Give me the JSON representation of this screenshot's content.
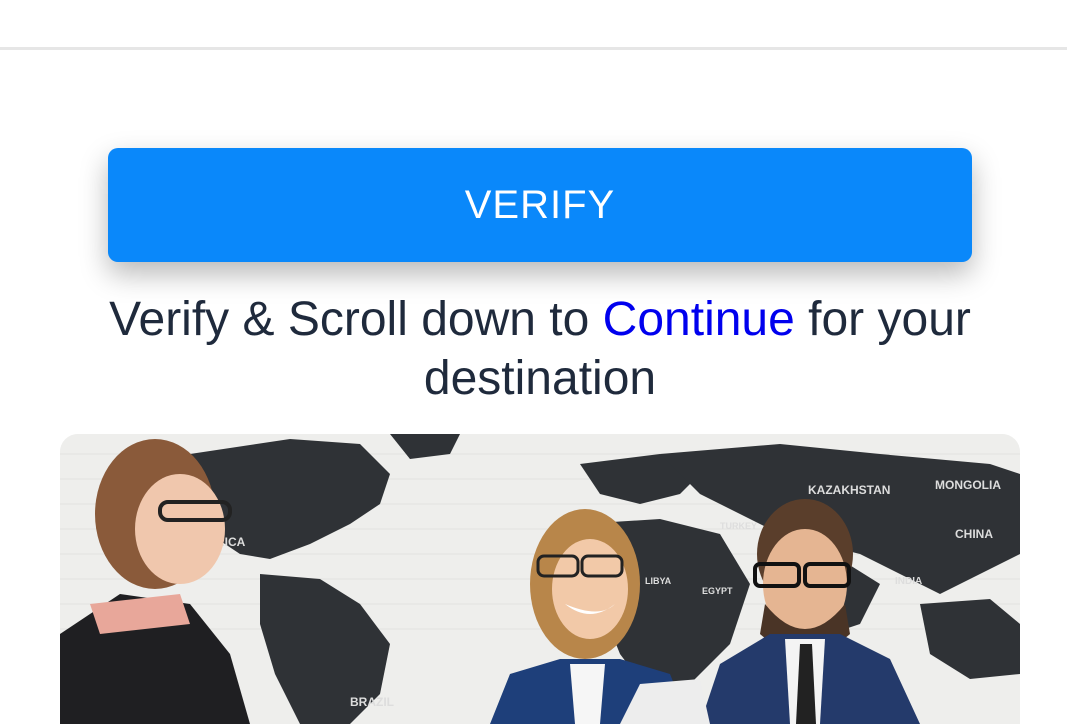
{
  "header": {},
  "verify": {
    "label": "VERIFY"
  },
  "message": {
    "prefix": "Verify & Scroll down to ",
    "link": "Continue",
    "suffix": " for your destination"
  },
  "hero": {
    "map_labels": {
      "kazakhstan": "KAZAKHSTAN",
      "mongolia": "MONGOLIA",
      "china": "CHINA",
      "america": "ERICA",
      "brazil": "BRAZIL",
      "egypt": "EGYPT",
      "india": "INDIA",
      "libya": "LIBYA",
      "turkey": "TURKEY"
    }
  },
  "colors": {
    "primary": "#0a88fa",
    "link": "#0000ee",
    "text": "#1f2a3c"
  }
}
